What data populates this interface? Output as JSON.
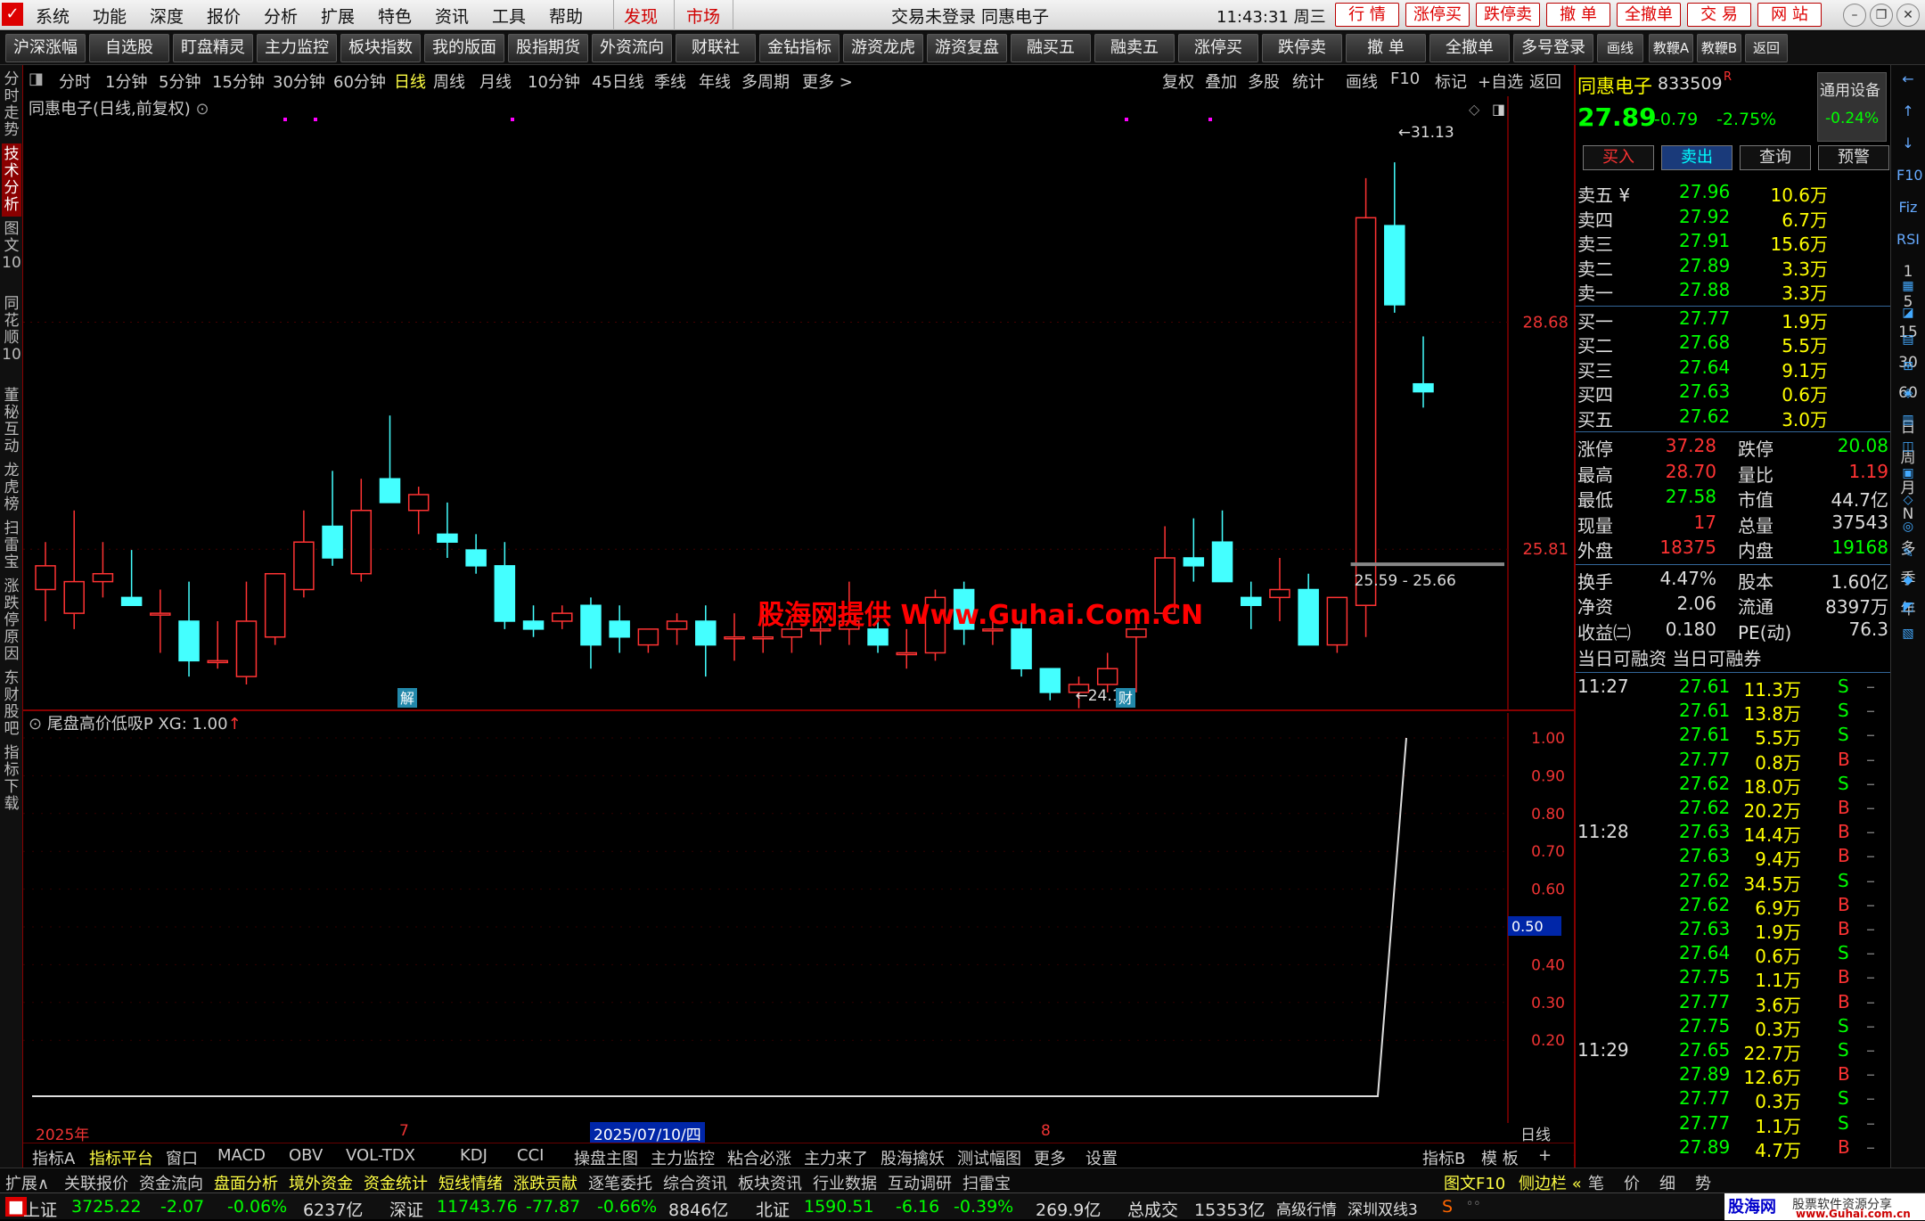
{
  "menubar": {
    "items": [
      "系统",
      "功能",
      "深度",
      "报价",
      "分析",
      "扩展",
      "特色",
      "资讯",
      "工具",
      "帮助",
      "发现",
      "市场"
    ],
    "status": "交易未登录  同惠电子",
    "clock": "11:43:31 周三",
    "right_buttons": [
      "行 情",
      "涨停买",
      "跌停卖",
      "撤 单",
      "全撤单",
      "交 易",
      "网 站"
    ]
  },
  "toolbar": [
    "沪深涨幅",
    "自选股",
    "盯盘精灵",
    "主力监控",
    "板块指数",
    "我的版面",
    "股指期货",
    "外资流向",
    "财联社",
    "金钻指标",
    "游资龙虎",
    "游资复盘",
    "融买五",
    "融卖五",
    "涨停买",
    "跌停卖",
    "撤 单",
    "全撤单",
    "多号登录",
    "画线",
    "教鞭A",
    "教鞭B",
    "返回"
  ],
  "leftside": [
    "分时走势",
    "技术分析",
    "图文10",
    "同花顺10",
    "董秘互动",
    "龙虎榜",
    "扫雷宝",
    "涨跌停原因",
    "东财股吧",
    "指标下载"
  ],
  "periods": {
    "items": [
      "分时",
      "1分钟",
      "5分钟",
      "15分钟",
      "30分钟",
      "60分钟",
      "日线",
      "周线",
      "月线",
      "10分钟",
      "45日线",
      "季线",
      "年线",
      "多周期",
      "更多 >"
    ],
    "tools": [
      "复权",
      "叠加",
      "多股",
      "统计",
      "画线",
      "F10",
      "标记",
      "+自选",
      "返回"
    ]
  },
  "chart": {
    "title": "同惠电子(日线,前复权)",
    "hi_label": "31.13",
    "lo_label": "24.10",
    "range_label": "25.59 - 25.66",
    "price_axis": [
      "28.68",
      "25.81"
    ],
    "markers": [
      "解",
      "财"
    ]
  },
  "chart_data": {
    "type": "candlestick",
    "series": [
      {
        "o": 25.3,
        "h": 25.9,
        "l": 24.9,
        "c": 25.6
      },
      {
        "o": 25.0,
        "h": 26.3,
        "l": 24.8,
        "c": 25.4
      },
      {
        "o": 25.4,
        "h": 25.9,
        "l": 25.2,
        "c": 25.5
      },
      {
        "o": 25.2,
        "h": 25.8,
        "l": 25.1,
        "c": 25.1
      },
      {
        "o": 25.0,
        "h": 25.3,
        "l": 24.5,
        "c": 25.0
      },
      {
        "o": 24.9,
        "h": 25.4,
        "l": 24.2,
        "c": 24.4
      },
      {
        "o": 24.4,
        "h": 24.9,
        "l": 24.3,
        "c": 24.4
      },
      {
        "o": 24.2,
        "h": 25.4,
        "l": 24.1,
        "c": 24.9
      },
      {
        "o": 24.7,
        "h": 25.5,
        "l": 24.6,
        "c": 25.5
      },
      {
        "o": 25.3,
        "h": 26.3,
        "l": 25.2,
        "c": 25.9
      },
      {
        "o": 26.1,
        "h": 26.8,
        "l": 25.6,
        "c": 25.7
      },
      {
        "o": 25.5,
        "h": 26.7,
        "l": 25.4,
        "c": 26.3
      },
      {
        "o": 26.7,
        "h": 27.5,
        "l": 26.4,
        "c": 26.4
      },
      {
        "o": 26.3,
        "h": 26.6,
        "l": 26.0,
        "c": 26.5
      },
      {
        "o": 26.0,
        "h": 26.4,
        "l": 25.7,
        "c": 25.9
      },
      {
        "o": 25.8,
        "h": 26.0,
        "l": 25.5,
        "c": 25.6
      },
      {
        "o": 25.6,
        "h": 25.9,
        "l": 24.8,
        "c": 24.9
      },
      {
        "o": 24.9,
        "h": 25.1,
        "l": 24.7,
        "c": 24.8
      },
      {
        "o": 24.9,
        "h": 25.1,
        "l": 24.8,
        "c": 25.0
      },
      {
        "o": 25.1,
        "h": 25.2,
        "l": 24.3,
        "c": 24.6
      },
      {
        "o": 24.9,
        "h": 25.1,
        "l": 24.5,
        "c": 24.7
      },
      {
        "o": 24.6,
        "h": 24.8,
        "l": 24.5,
        "c": 24.8
      },
      {
        "o": 24.8,
        "h": 25.0,
        "l": 24.6,
        "c": 24.9
      },
      {
        "o": 24.9,
        "h": 25.1,
        "l": 24.2,
        "c": 24.6
      },
      {
        "o": 24.7,
        "h": 25.0,
        "l": 24.4,
        "c": 24.7
      },
      {
        "o": 24.7,
        "h": 25.1,
        "l": 24.5,
        "c": 24.7
      },
      {
        "o": 24.7,
        "h": 24.9,
        "l": 24.5,
        "c": 24.8
      },
      {
        "o": 24.8,
        "h": 24.9,
        "l": 24.6,
        "c": 24.8
      },
      {
        "o": 24.8,
        "h": 25.4,
        "l": 24.6,
        "c": 24.9
      },
      {
        "o": 24.8,
        "h": 25.0,
        "l": 24.5,
        "c": 24.6
      },
      {
        "o": 24.5,
        "h": 24.8,
        "l": 24.3,
        "c": 24.5
      },
      {
        "o": 24.5,
        "h": 25.3,
        "l": 24.4,
        "c": 25.2
      },
      {
        "o": 25.3,
        "h": 25.4,
        "l": 24.6,
        "c": 24.8
      },
      {
        "o": 24.8,
        "h": 24.9,
        "l": 24.6,
        "c": 24.8
      },
      {
        "o": 24.8,
        "h": 24.9,
        "l": 24.2,
        "c": 24.3
      },
      {
        "o": 24.3,
        "h": 24.3,
        "l": 23.9,
        "c": 24.0
      },
      {
        "o": 24.0,
        "h": 24.2,
        "l": 23.8,
        "c": 24.1
      },
      {
        "o": 24.1,
        "h": 24.5,
        "l": 24.0,
        "c": 24.3
      },
      {
        "o": 24.7,
        "h": 24.9,
        "l": 24.0,
        "c": 24.8
      },
      {
        "o": 25.0,
        "h": 26.1,
        "l": 24.9,
        "c": 25.7
      },
      {
        "o": 25.7,
        "h": 26.2,
        "l": 25.4,
        "c": 25.6
      },
      {
        "o": 25.9,
        "h": 26.3,
        "l": 25.4,
        "c": 25.4
      },
      {
        "o": 25.2,
        "h": 25.4,
        "l": 24.8,
        "c": 25.1
      },
      {
        "o": 25.2,
        "h": 25.7,
        "l": 24.9,
        "c": 25.3
      },
      {
        "o": 25.3,
        "h": 25.5,
        "l": 24.8,
        "c": 24.6
      },
      {
        "o": 24.6,
        "h": 25.2,
        "l": 24.5,
        "c": 25.2
      },
      {
        "o": 25.1,
        "h": 30.5,
        "l": 24.7,
        "c": 30.0
      },
      {
        "o": 29.9,
        "h": 30.7,
        "l": 28.8,
        "c": 28.9
      },
      {
        "o": 27.9,
        "h": 28.5,
        "l": 27.6,
        "c": 27.8
      }
    ],
    "indicator": {
      "name": "尾盘高价低吸P",
      "xg_label": "XG: 1.00",
      "yticks": [
        "1.00",
        "0.90",
        "0.80",
        "0.70",
        "0.60",
        "0.50",
        "0.40",
        "0.30",
        "0.20"
      ]
    },
    "xlabels": [
      "2025年",
      "7",
      "2025/07/10/四",
      "8"
    ]
  },
  "tabs1": [
    "指标A",
    "指标平台",
    "窗口",
    "MACD",
    "OBV",
    "VOL-TDX",
    "KDJ",
    "CCI",
    "操盘主图",
    "主力监控",
    "粘合必涨",
    "主力来了",
    "股海擒妖",
    "测试幅图",
    "更多",
    "设置"
  ],
  "tabs1_right": [
    "指标B",
    "模 板",
    "+",
    "−"
  ],
  "tabs2": [
    "扩展∧",
    "关联报价",
    "资金流向",
    "盘面分析",
    "境外资金",
    "资金统计",
    "短线情绪",
    "涨跌贡献",
    "逐笔委托",
    "综合资讯",
    "板块资讯",
    "行业数据",
    "互动调研",
    "扫雷宝"
  ],
  "tabs2_right": [
    "图文F10",
    "侧边栏 «",
    "笔",
    "价",
    "细",
    "势"
  ],
  "statusbar": {
    "sh": "上证",
    "sh_v": "3725.22",
    "sh_c": "-2.07",
    "sh_p": "-0.06%",
    "sh_a": "6237亿",
    "sz": "深证",
    "sz_v": "11743.76",
    "sz_c": "-77.87",
    "sz_p": "-0.66%",
    "sz_a": "8846亿",
    "bz": "北证",
    "bz_v": "1590.51",
    "bz_c": "-6.16",
    "bz_p": "-0.39%",
    "bz_a": "269.9亿",
    "total": "总成交",
    "total_v": "15353亿",
    "mode": "高级行情",
    "line": "深圳双线3",
    "site": "股海网",
    "site2": "股票软件资源分享",
    "url": "www.Guhai.com.cn"
  },
  "quote": {
    "name": "同惠电子",
    "code": "833509",
    "flag": "R",
    "setting": "通用设备",
    "setting_pct": "-0.24%",
    "price": "27.89",
    "chg": "-0.79",
    "pct": "-2.75%",
    "buttons": [
      "买入",
      "卖出",
      "查询",
      "预警"
    ],
    "asks": [
      [
        "卖五",
        "27.96",
        "10.6万"
      ],
      [
        "卖四",
        "27.92",
        "6.7万"
      ],
      [
        "卖三",
        "27.91",
        "15.6万"
      ],
      [
        "卖二",
        "27.89",
        "3.3万"
      ],
      [
        "卖一",
        "27.88",
        "3.3万"
      ]
    ],
    "bids": [
      [
        "买一",
        "27.77",
        "1.9万"
      ],
      [
        "买二",
        "27.68",
        "5.5万"
      ],
      [
        "买三",
        "27.64",
        "9.1万"
      ],
      [
        "买四",
        "27.63",
        "0.6万"
      ],
      [
        "买五",
        "27.62",
        "3.0万"
      ]
    ],
    "stats": [
      [
        "涨停",
        "37.28",
        "跌停",
        "20.08"
      ],
      [
        "最高",
        "28.70",
        "量比",
        "1.19"
      ],
      [
        "最低",
        "27.58",
        "市值",
        "44.7亿"
      ],
      [
        "现量",
        "17",
        "总量",
        "37543"
      ],
      [
        "外盘",
        "18375",
        "内盘",
        "19168"
      ]
    ],
    "stats2": [
      [
        "换手",
        "4.47%",
        "股本",
        "1.60亿"
      ],
      [
        "净资",
        "2.06",
        "流通",
        "8397万"
      ],
      [
        "收益㈡",
        "0.180",
        "PE(动)",
        "76.3"
      ]
    ],
    "margin": "当日可融资  当日可融券",
    "ticks": [
      [
        "11:27",
        "27.61",
        "11.3万",
        "S"
      ],
      [
        "",
        "27.61",
        "13.8万",
        "S"
      ],
      [
        "",
        "27.61",
        "5.5万",
        "S"
      ],
      [
        "",
        "27.77",
        "0.8万",
        "B"
      ],
      [
        "",
        "27.62",
        "18.0万",
        "S"
      ],
      [
        "",
        "27.62",
        "20.2万",
        "B"
      ],
      [
        "11:28",
        "27.63",
        "14.4万",
        "B"
      ],
      [
        "",
        "27.63",
        "9.4万",
        "B"
      ],
      [
        "",
        "27.62",
        "34.5万",
        "S"
      ],
      [
        "",
        "27.62",
        "6.9万",
        "B"
      ],
      [
        "",
        "27.63",
        "1.9万",
        "B"
      ],
      [
        "",
        "27.64",
        "0.6万",
        "S"
      ],
      [
        "",
        "27.75",
        "1.1万",
        "B"
      ],
      [
        "",
        "27.77",
        "3.6万",
        "B"
      ],
      [
        "",
        "27.75",
        "0.3万",
        "S"
      ],
      [
        "11:29",
        "27.65",
        "22.7万",
        "S"
      ],
      [
        "",
        "27.89",
        "12.6万",
        "B"
      ],
      [
        "",
        "27.77",
        "0.3万",
        "S"
      ],
      [
        "",
        "27.77",
        "1.1万",
        "S"
      ],
      [
        "",
        "27.89",
        "4.7万",
        "B"
      ]
    ]
  },
  "righticons": [
    "←",
    "↑",
    "↓",
    "F10",
    "Fiz",
    "RSI",
    "1",
    "5",
    "15",
    "30",
    "60",
    "日",
    "周",
    "月",
    "N",
    "多",
    "季",
    "年"
  ],
  "watermark": "股海网提供 Www.Guhai.Com.CN"
}
